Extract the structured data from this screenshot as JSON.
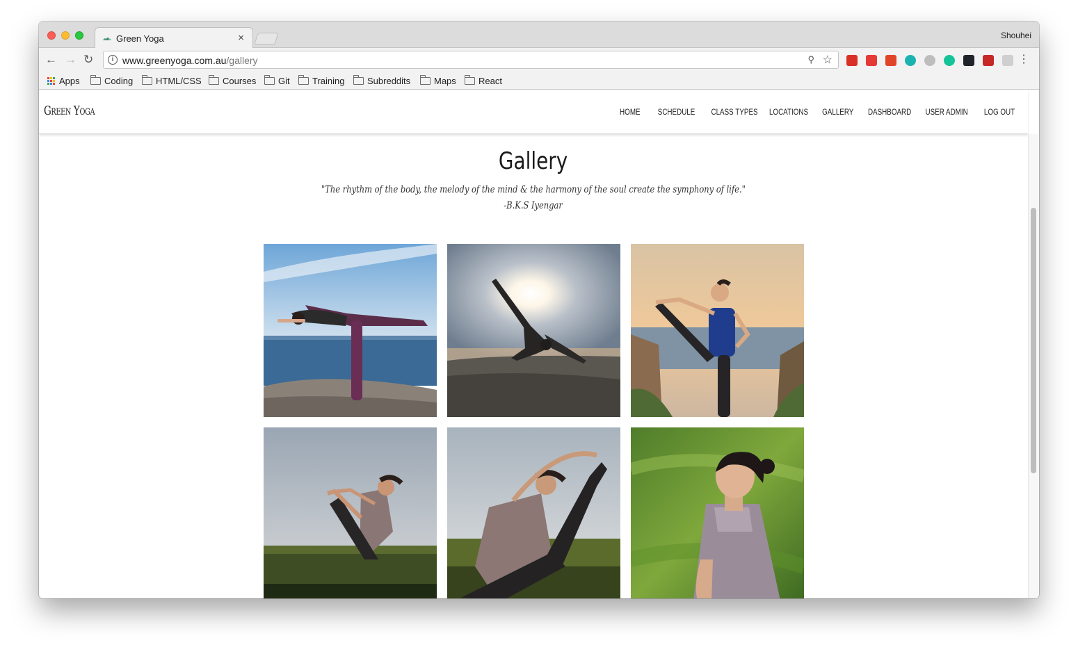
{
  "browser": {
    "tab_title": "Green Yoga",
    "tab_close": "×",
    "profile_name": "Shouhei",
    "url_host": "www.greenyoga.com.au",
    "url_path": "/gallery",
    "bookmarks": {
      "apps": "Apps",
      "items": [
        "Coding",
        "HTML/CSS",
        "Courses",
        "Git",
        "Training",
        "Subreddits",
        "Maps",
        "React"
      ]
    },
    "extensions": [
      {
        "icon": "video-extension-icon",
        "color": "#d93025"
      },
      {
        "icon": "opera-icon",
        "color": "#e53935"
      },
      {
        "icon": "bookmark-extension-icon",
        "color": "#e0452a"
      },
      {
        "icon": "m-extension-icon",
        "color": "#1ab3b0"
      },
      {
        "icon": "circle-extension-icon",
        "color": "#bdbdbd"
      },
      {
        "icon": "grammarly-icon",
        "color": "#15c39a"
      },
      {
        "icon": "react-devtools-icon",
        "color": "#20232a"
      },
      {
        "icon": "cors-extension-icon",
        "color": "#c62828"
      },
      {
        "icon": "cloud-extension-icon",
        "color": "#cfcfcf"
      }
    ]
  },
  "site": {
    "logo": "Green Yoga",
    "nav": [
      "Home",
      "Schedule",
      "Class Types",
      "Locations",
      "Gallery",
      "Dashboard",
      "User Admin",
      "Log Out"
    ],
    "title": "Gallery",
    "quote": "\"The rhythm of the body, the melody of the mind & the harmony of the soul create the symphony of life.\"",
    "quote_author": "-B.K.S Iyengar"
  }
}
